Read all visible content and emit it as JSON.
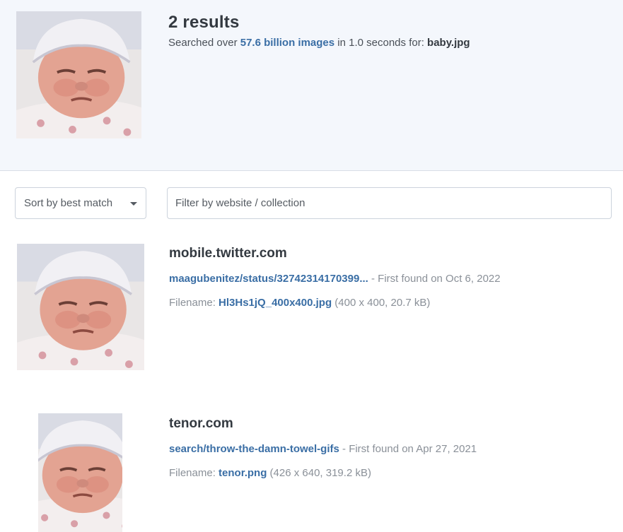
{
  "header": {
    "results_count": "2 results",
    "summary_prefix": "Searched over ",
    "images_link": "57.6 billion images",
    "summary_middle": " in 1.0 seconds for: ",
    "query_filename": "baby.jpg",
    "query_image": "newborn-baby-photo"
  },
  "controls": {
    "sort_label": "Sort by best match",
    "filter_placeholder": "Filter by website / collection"
  },
  "results": [
    {
      "domain": "mobile.twitter.com",
      "path": "maagubenitez/status/32742314170399...",
      "found_text": "  - First found on Oct 6, 2022",
      "filename_label": "Filename: ",
      "filename": "Hl3Hs1jQ_400x400.jpg",
      "file_info": " (400 x 400, 20.7 kB)",
      "image": "newborn-baby-photo"
    },
    {
      "domain": "tenor.com",
      "path": "search/throw-the-damn-towel-gifs",
      "found_text": " - First found on Apr 27, 2021",
      "filename_label": "Filename: ",
      "filename": "tenor.png",
      "file_info": " (426 x 640, 319.2 kB)",
      "image": "newborn-baby-photo"
    }
  ]
}
